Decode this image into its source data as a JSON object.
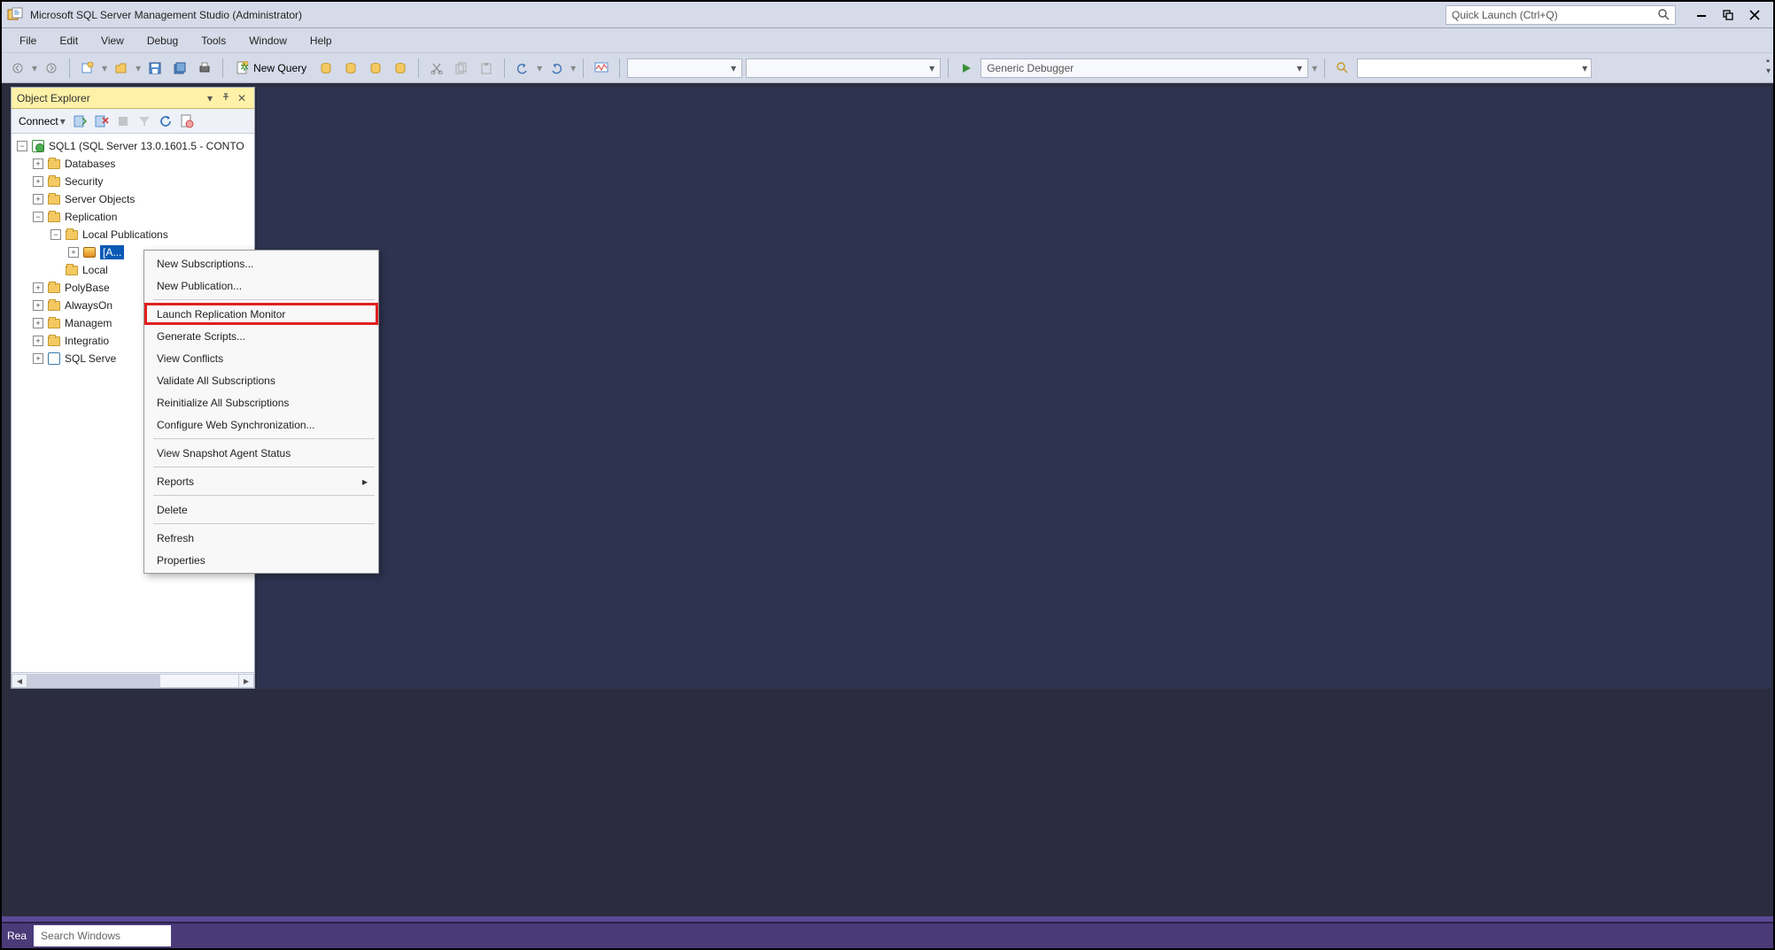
{
  "title": "Microsoft SQL Server Management Studio (Administrator)",
  "quick_launch_placeholder": "Quick Launch (Ctrl+Q)",
  "menu": [
    "File",
    "Edit",
    "View",
    "Debug",
    "Tools",
    "Window",
    "Help"
  ],
  "toolbar": {
    "new_query": "New Query",
    "debugger": "Generic Debugger"
  },
  "object_explorer": {
    "title": "Object Explorer",
    "connect": "Connect",
    "server": "SQL1 (SQL Server 13.0.1601.5 - CONTO",
    "nodes": {
      "databases": "Databases",
      "security": "Security",
      "server_objects": "Server Objects",
      "replication": "Replication",
      "local_publications": "Local Publications",
      "publication_item": "[A...",
      "local_subscriptions": "Local",
      "polybase": "PolyBase",
      "alwayson": "AlwaysOn",
      "management": "Managem",
      "integration": "Integratio",
      "sql_agent": "SQL Serve"
    }
  },
  "context_menu": {
    "new_subscriptions": "New Subscriptions...",
    "new_publication": "New Publication...",
    "launch_replication_monitor": "Launch Replication Monitor",
    "generate_scripts": "Generate Scripts...",
    "view_conflicts": "View Conflicts",
    "validate_all": "Validate All Subscriptions",
    "reinitialize_all": "Reinitialize All Subscriptions",
    "configure_web_sync": "Configure Web Synchronization...",
    "view_snapshot": "View Snapshot Agent Status",
    "reports": "Reports",
    "delete": "Delete",
    "refresh": "Refresh",
    "properties": "Properties"
  },
  "taskbar": {
    "status": "Rea",
    "search_placeholder": "Search Windows"
  }
}
